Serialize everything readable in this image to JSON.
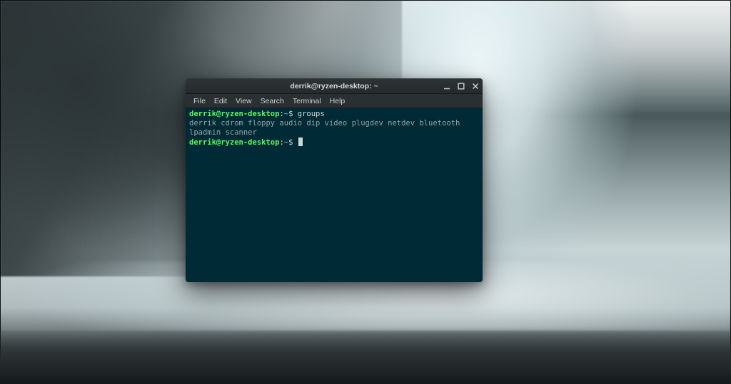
{
  "window": {
    "title": "derrik@ryzen-desktop: ~",
    "controls": {
      "min_name": "minimize-icon",
      "max_name": "maximize-icon",
      "close_name": "close-icon"
    }
  },
  "menubar": {
    "items": [
      {
        "label": "File"
      },
      {
        "label": "Edit"
      },
      {
        "label": "View"
      },
      {
        "label": "Search"
      },
      {
        "label": "Terminal"
      },
      {
        "label": "Help"
      }
    ]
  },
  "terminal": {
    "lines": [
      {
        "prompt": {
          "user_host": "derrik@ryzen-desktop",
          "sep": ":",
          "path": "~",
          "symbol": "$"
        },
        "command": "groups"
      },
      {
        "output": "derrik cdrom floppy audio dip video plugdev netdev bluetooth lpadmin scanner"
      },
      {
        "prompt": {
          "user_host": "derrik@ryzen-desktop",
          "sep": ":",
          "path": "~",
          "symbol": "$"
        },
        "cursor": true
      }
    ]
  },
  "colors": {
    "terminal_bg": "#002b36",
    "prompt_user": "#5af75a",
    "prompt_path": "#6a9fb5",
    "output_text": "#93a1a1"
  }
}
